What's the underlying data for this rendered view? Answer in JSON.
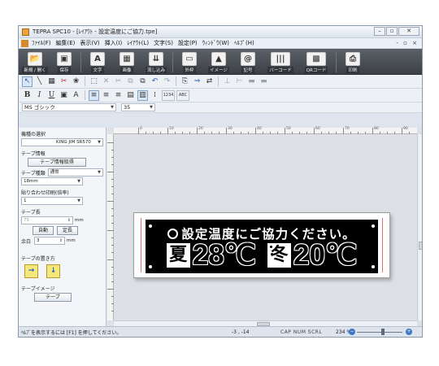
{
  "window": {
    "title": "TEPRA SPC10 - [ﾚｲｱｳﾄ - 設定温度にご協力.tpe]"
  },
  "menu": {
    "items": [
      "ﾌｧｲﾙ(F)",
      "編集(E)",
      "表示(V)",
      "挿入(I)",
      "ﾚｲｱｳﾄ(L)",
      "文字(S)",
      "設定(P)",
      "ｳｨﾝﾄﾞｳ(W)",
      "ﾍﾙﾌﾟ(H)"
    ],
    "right_controls": "- ▫ ×"
  },
  "ribbon": {
    "buttons": [
      {
        "label": "新規 / 開く",
        "icon": "open-file-icon",
        "glyph": "📂"
      },
      {
        "label": "保存",
        "icon": "save-icon",
        "glyph": "▣"
      },
      {
        "label": "文字",
        "icon": "text-icon",
        "glyph": "A"
      },
      {
        "label": "画像",
        "icon": "image-icon",
        "glyph": "▦"
      },
      {
        "label": "流し込み",
        "icon": "merge-icon",
        "glyph": "⇊"
      },
      {
        "label": "外枠",
        "icon": "frame-icon",
        "glyph": "▭"
      },
      {
        "label": "イメージ",
        "icon": "picture-icon",
        "glyph": "▲"
      },
      {
        "label": "記号",
        "icon": "symbol-icon",
        "glyph": "@"
      },
      {
        "label": "バーコード",
        "icon": "barcode-icon",
        "glyph": "|||"
      },
      {
        "label": "QRコード",
        "icon": "qrcode-icon",
        "glyph": "▩"
      },
      {
        "label": "印刷",
        "icon": "print-icon",
        "glyph": "⎙"
      }
    ]
  },
  "toolbar": {
    "row1_glyphs": [
      "↖",
      "╲",
      "▦",
      "✂",
      "❀",
      "⬚",
      "✕",
      "✂",
      "⧉",
      "⧉",
      "↶",
      "↷",
      "⎘",
      "⇒",
      "⇄",
      "⊥",
      "⊢",
      "▬",
      "▬"
    ],
    "row2_glyphs": [
      "B",
      "I",
      "U",
      "▣",
      "A",
      "≡",
      "≡",
      "≡",
      "▤",
      "▥",
      "⁞",
      "1234",
      "ABC"
    ]
  },
  "fontbar": {
    "font_name": "MS ゴシック",
    "font_size": "35"
  },
  "side_panel": {
    "model_label": "機種の選択",
    "model_value": "KING JIM SR570",
    "tape_info_label": "テープ情報",
    "tape_info_button": "テープ情報取得",
    "tape_type_label": "テープ種類",
    "tape_type_value": "通常",
    "tape_width_value": "18mm",
    "print_count_label": "貼り合わせ印刷(倍率)",
    "print_count_value": "1",
    "tape_length_label": "テープ長",
    "tape_length_value": "75",
    "tape_length_unit": "mm",
    "auto_button": "自動",
    "fixed_button": "定長",
    "margin_label": "余白",
    "margin_value": "3",
    "margin_unit": "mm",
    "orientation_label": "テープの置き方",
    "orientation_h_glyph": "→",
    "orientation_v_glyph": "↓",
    "tape_image_label": "テープイメージ",
    "tape_image_button": "テープ"
  },
  "ruler": {
    "h_labels": [
      "0",
      "10",
      "20",
      "30",
      "40",
      "50",
      "60",
      "70",
      "80",
      "90"
    ]
  },
  "label": {
    "line1": "設定温度にご協力ください。",
    "summer_char": "夏",
    "summer_temp": "28℃",
    "winter_char": "冬",
    "winter_temp": "20℃"
  },
  "status": {
    "help_text": "ﾍﾙﾌﾟを表示するには [F1] を押してください。",
    "coords": "-3 , -14",
    "caps": "CAP  NUM  SCRL",
    "zoom": "234 %",
    "zoom_minus": "−",
    "zoom_plus": "+"
  }
}
